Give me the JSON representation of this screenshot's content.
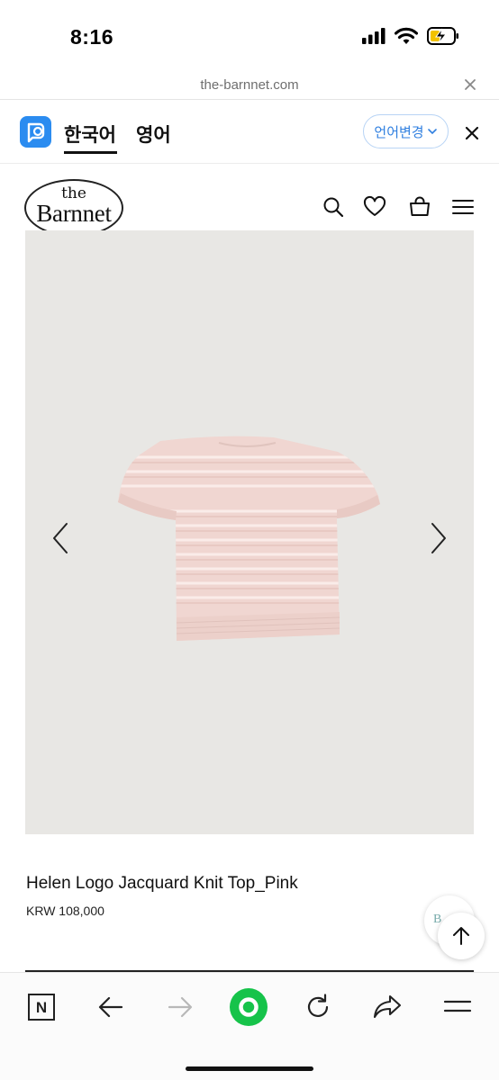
{
  "status_bar": {
    "time": "8:16",
    "icons": [
      "signal-icon",
      "wifi-icon",
      "battery-charging-icon"
    ]
  },
  "browser": {
    "url": "the-barnnet.com",
    "close_icon": "close-icon"
  },
  "translate_bar": {
    "app_icon": "papago-icon",
    "tabs": [
      {
        "label": "한국어",
        "active": true
      },
      {
        "label": "영어",
        "active": false
      }
    ],
    "change_language_label": "언어변경",
    "close_icon": "close-icon",
    "accent_color": "#2f7fe0"
  },
  "site_header": {
    "logo_top": "the",
    "logo_name": "Barnnet",
    "icons": [
      "search-icon",
      "heart-icon",
      "cart-icon",
      "menu-icon"
    ]
  },
  "product": {
    "name": "Helen Logo Jacquard Knit Top_Pink",
    "price": "KRW 108,000",
    "image_background": "#e8e7e4",
    "garment_color": "#f0d6d1",
    "carousel_prev_icon": "chevron-left-icon",
    "carousel_next_icon": "chevron-right-icon"
  },
  "floating": {
    "badge_text": "B",
    "scroll_top_icon": "arrow-up-icon"
  },
  "bottom_toolbar": {
    "items": [
      {
        "name": "naver-home-icon",
        "label": "N"
      },
      {
        "name": "back-arrow-icon"
      },
      {
        "name": "forward-arrow-icon"
      },
      {
        "name": "green-dot-icon"
      },
      {
        "name": "refresh-icon"
      },
      {
        "name": "share-icon"
      },
      {
        "name": "menu-icon"
      }
    ],
    "green_color": "#16c34a"
  }
}
